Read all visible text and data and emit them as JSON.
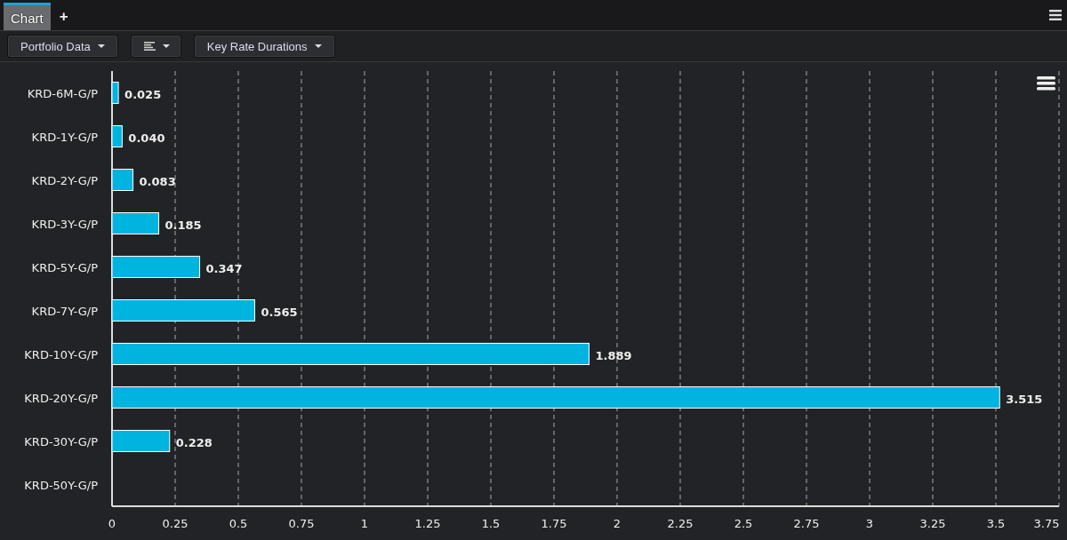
{
  "tabs": [
    {
      "label": "Chart",
      "selected": true
    }
  ],
  "add_tab": "+",
  "toolbar": [
    {
      "kind": "text",
      "label": "Portfolio Data"
    },
    {
      "kind": "icon"
    },
    {
      "kind": "text",
      "label": "Key Rate Durations"
    }
  ],
  "chart": {
    "chart_data": {
      "type": "bar",
      "orientation": "horizontal",
      "categories": [
        "KRD-6M-G/P",
        "KRD-1Y-G/P",
        "KRD-2Y-G/P",
        "KRD-3Y-G/P",
        "KRD-5Y-G/P",
        "KRD-7Y-G/P",
        "KRD-10Y-G/P",
        "KRD-20Y-G/P",
        "KRD-30Y-G/P",
        "KRD-50Y-G/P"
      ],
      "grid": true,
      "series": [
        {
          "color": "#00b4e0",
          "values": [
            0.025,
            0.04,
            0.083,
            0.185,
            0.347,
            0.565,
            1.889,
            3.515,
            0.228,
            null
          ]
        }
      ],
      "value_labels": [
        "0.025",
        "0.040",
        "0.083",
        "0.185",
        "0.347",
        "0.565",
        "1.889",
        "3.515",
        "0.228",
        null
      ],
      "xlim": [
        0,
        3.75
      ],
      "xticks": [
        {
          "value": 0,
          "label": "0"
        },
        {
          "value": 0.25,
          "label": "0.25"
        },
        {
          "value": 0.5,
          "label": "0.5"
        },
        {
          "value": 0.75,
          "label": "0.75"
        },
        {
          "value": 1,
          "label": "1"
        },
        {
          "value": 1.25,
          "label": "1.25"
        },
        {
          "value": 1.5,
          "label": "1.5"
        },
        {
          "value": 1.75,
          "label": "1.75"
        },
        {
          "value": 2,
          "label": "2"
        },
        {
          "value": 2.25,
          "label": "2.25"
        },
        {
          "value": 2.5,
          "label": "2.5"
        },
        {
          "value": 2.75,
          "label": "2.75"
        },
        {
          "value": 3,
          "label": "3"
        },
        {
          "value": 3.25,
          "label": "3.25"
        },
        {
          "value": 3.5,
          "label": "3.5"
        },
        {
          "value": 3.75,
          "label": "3.75"
        }
      ]
    }
  }
}
